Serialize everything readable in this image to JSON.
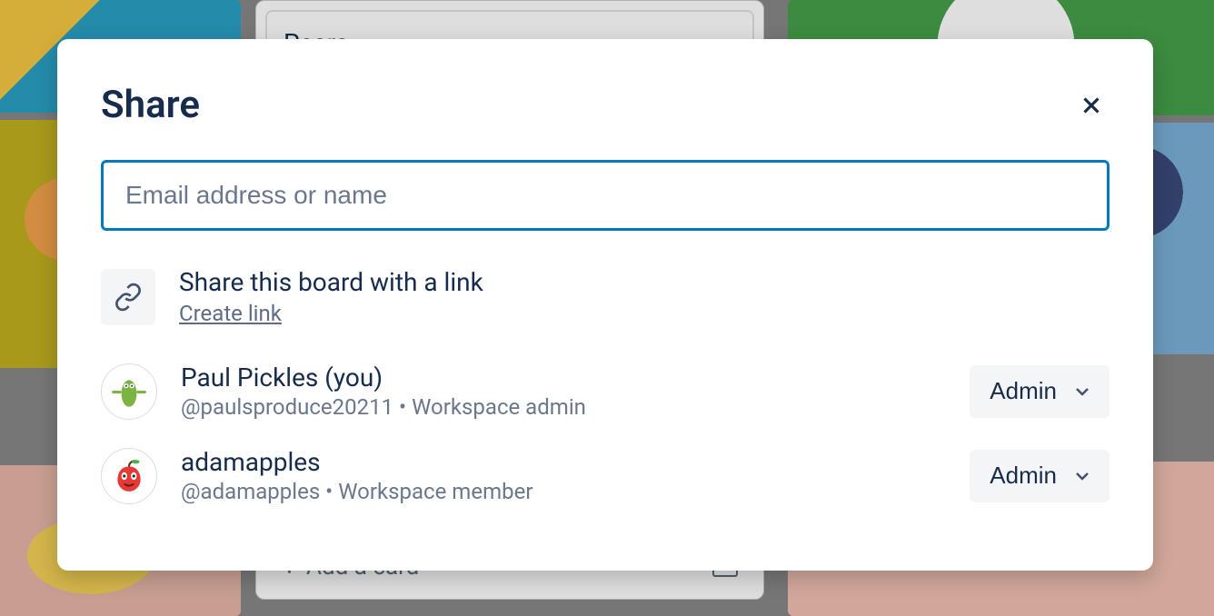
{
  "background": {
    "card_title": "Pears",
    "add_card_label": "Add a card"
  },
  "modal": {
    "title": "Share",
    "input_placeholder": "Email address or name",
    "link_section": {
      "title": "Share this board with a link",
      "action": "Create link"
    },
    "members": [
      {
        "name": "Paul Pickles (you)",
        "handle": "@paulsproduce20211",
        "role_label": "Workspace admin",
        "permission": "Admin",
        "avatar_kind": "pickle"
      },
      {
        "name": "adamapples",
        "handle": "@adamapples",
        "role_label": "Workspace member",
        "permission": "Admin",
        "avatar_kind": "apple"
      }
    ]
  }
}
